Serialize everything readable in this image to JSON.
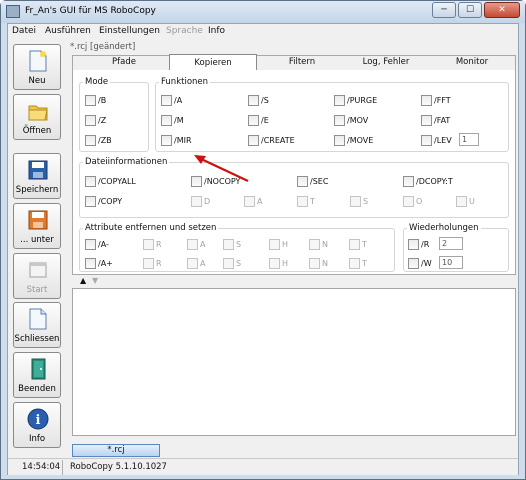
{
  "window": {
    "title": "Fr_An's GUI für MS RoboCopy",
    "min": "─",
    "max": "☐",
    "close": "✕"
  },
  "menu": [
    {
      "label": "Datei"
    },
    {
      "label": "Ausführen"
    },
    {
      "label": "Einstellungen"
    },
    {
      "label": "Sprache",
      "disabled": true
    },
    {
      "label": "Info"
    }
  ],
  "toolbar": {
    "neu": "Neu",
    "oeffnen": "Öffnen",
    "speichern": "Speichern",
    "unter": "... unter",
    "start": "Start",
    "schliessen": "Schliessen",
    "beenden": "Beenden",
    "info": "Info"
  },
  "file_tab": "*.rcj [geändert]",
  "tabs": [
    {
      "label": "Pfade"
    },
    {
      "label": "Kopieren",
      "active": true
    },
    {
      "label": "Filtern"
    },
    {
      "label": "Log, Fehler"
    },
    {
      "label": "Monitor"
    }
  ],
  "mode": {
    "title": "Mode",
    "items": [
      "/B",
      "/Z",
      "/ZB"
    ]
  },
  "funktionen": {
    "title": "Funktionen",
    "col1": [
      "/A",
      "/M",
      "/MIR"
    ],
    "col2": [
      "/S",
      "/E",
      "/CREATE"
    ],
    "col3": [
      "/PURGE",
      "/MOV",
      "/MOVE"
    ],
    "col4": [
      "/FFT",
      "/FAT",
      "/LEV"
    ],
    "lev_value": "1"
  },
  "dateiinfo": {
    "title": "Dateiinformationen",
    "row1": [
      "/COPYALL",
      "/NOCOPY",
      "/SEC",
      "/DCOPY:T"
    ],
    "row2_main": "/COPY",
    "row2_sub": [
      "D",
      "A",
      "T",
      "S",
      "O",
      "U"
    ]
  },
  "attribute": {
    "title": "Attribute entfernen und setzen",
    "rows": [
      "/A-",
      "/A+"
    ],
    "letters": [
      "R",
      "A",
      "S",
      "H",
      "N",
      "T"
    ]
  },
  "wiederholungen": {
    "title": "Wiederholungen",
    "r_label": "/R",
    "r_value": "2",
    "w_label": "/W",
    "w_value": "10"
  },
  "splitter": {
    "up": "▲",
    "down": "▼"
  },
  "bottom_tab": "*.rcj",
  "status": {
    "time": "14:54:04",
    "version": "RoboCopy 5.1.10.1027"
  },
  "colors": {
    "arrow": "#cc1111",
    "tab_highlight": "#b8d4f1"
  }
}
